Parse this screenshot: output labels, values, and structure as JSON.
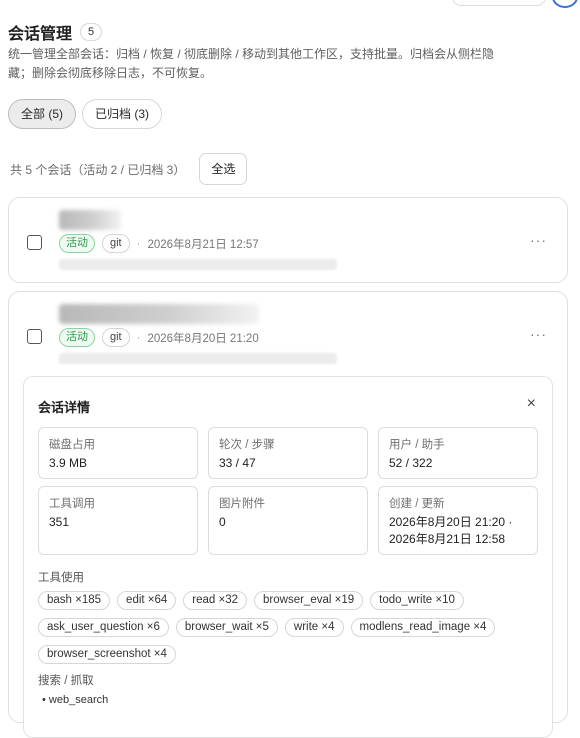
{
  "header": {
    "title": "会话管理",
    "count": "5",
    "description": "统一管理全部会话：归档 / 恢复 / 彻底删除 / 移动到其他工作区，支持批量。归档会从侧栏隐藏；删除会彻底移除日志，不可恢复。"
  },
  "filters": [
    {
      "label": "全部 (5)",
      "active": true
    },
    {
      "label": "已归档 (3)",
      "active": false
    }
  ],
  "summary": {
    "text": "共 5 个会话（活动 2 / 已归档 3）",
    "select_all": "全选"
  },
  "sessions": [
    {
      "status": "活动",
      "tag": "git",
      "separator": "·",
      "time": "2026年8月21日 12:57",
      "more": "···"
    },
    {
      "status": "活动",
      "tag": "git",
      "separator": "·",
      "time": "2026年8月20日 21:20",
      "more": "···"
    }
  ],
  "detail": {
    "title": "会话详情",
    "close": "×",
    "stats": [
      {
        "label": "磁盘占用",
        "value": "3.9 MB"
      },
      {
        "label": "轮次 / 步骤",
        "value": "33 / 47"
      },
      {
        "label": "用户 / 助手",
        "value": "52 / 322"
      },
      {
        "label": "工具调用",
        "value": "351"
      },
      {
        "label": "图片附件",
        "value": "0"
      },
      {
        "label": "创建 / 更新",
        "value": "2026年8月20日 21:20 · 2026年8月21日 12:58"
      }
    ],
    "tools_label": "工具使用",
    "tools": [
      "bash ×185",
      "edit ×64",
      "read ×32",
      "browser_eval ×19",
      "todo_write ×10",
      "ask_user_question ×6",
      "browser_wait ×5",
      "write ×4",
      "modlens_read_image ×4",
      "browser_screenshot ×4"
    ],
    "search_label": "搜索 / 抓取",
    "search_items": [
      "web_search"
    ]
  }
}
